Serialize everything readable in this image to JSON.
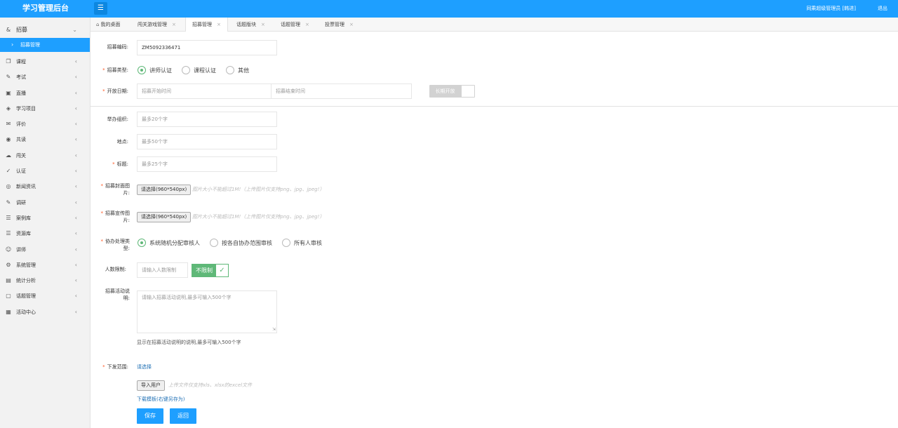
{
  "header": {
    "brand": "学习管理后台",
    "menu_icon": "hamburger-icon",
    "user": "同乘超级管理员 [韩进]",
    "logout": "退出"
  },
  "sidebar": {
    "groups": [
      {
        "label": "招募",
        "icon": "ampersand-icon",
        "open": true
      },
      {
        "label": "课程",
        "icon": "book-icon"
      },
      {
        "label": "考试",
        "icon": "edit-icon"
      },
      {
        "label": "直播",
        "icon": "video-icon"
      },
      {
        "label": "学习项目",
        "icon": "layers-icon"
      },
      {
        "label": "评价",
        "icon": "comment-icon"
      },
      {
        "label": "共读",
        "icon": "eye-icon"
      },
      {
        "label": "闯关",
        "icon": "cloud-icon"
      },
      {
        "label": "认证",
        "icon": "check-circle-icon"
      },
      {
        "label": "新闻资讯",
        "icon": "news-icon"
      },
      {
        "label": "调研",
        "icon": "survey-icon"
      },
      {
        "label": "案例库",
        "icon": "database-icon"
      },
      {
        "label": "资源库",
        "icon": "stack-icon"
      },
      {
        "label": "讲师",
        "icon": "user-icon"
      },
      {
        "label": "系统管理",
        "icon": "gear-icon"
      },
      {
        "label": "统计分析",
        "icon": "chart-icon"
      },
      {
        "label": "话题管理",
        "icon": "topic-icon"
      },
      {
        "label": "活动中心",
        "icon": "activity-icon"
      }
    ],
    "sub_item": "招募管理"
  },
  "tabs": [
    {
      "label": "我的桌面",
      "icon": "home-icon"
    },
    {
      "label": "闯关游戏管理"
    },
    {
      "label": "招募管理",
      "active": true
    },
    {
      "label": "话题版块"
    },
    {
      "label": "话题管理"
    },
    {
      "label": "投票管理"
    }
  ],
  "form": {
    "code_label": "招募编码:",
    "code_value": "ZM5092336471",
    "type_label": "招募类型:",
    "type_options": [
      "讲师认证",
      "课程认证",
      "其他"
    ],
    "date_label": "开放日期:",
    "start_placeholder": "招募开始时间",
    "end_placeholder": "招募结束时间",
    "long_term": "长期开放",
    "org_label": "举办组织:",
    "org_placeholder": "最多20个字",
    "place_label": "地点:",
    "place_placeholder": "最多50个字",
    "title_label": "标题:",
    "title_placeholder": "最多25个字",
    "cover_label": "招募封面图片:",
    "cover_btn": "请选择(960*540px)",
    "cover_hint": "图片大小不能超过1M!（上传图片仅支持png、jpg、jpeg!）",
    "promo_label": "招募宣传图片:",
    "promo_btn": "请选择(960*540px)",
    "promo_hint": "图片大小不能超过1M!（上传图片仅支持png、jpg、jpeg!）",
    "assist_label": "协办处理类型:",
    "assist_options": [
      "系统随机分配审核人",
      "按各自协办范围审核",
      "所有人审核"
    ],
    "count_label": "人数限制:",
    "count_placeholder": "请输入人数限制",
    "unlimited": "不限制",
    "desc_label": "招募活动说明:",
    "desc_placeholder": "请输入招募活动说明,最多可输入500个字",
    "desc_help": "显示在招募活动说明的说明,最多可输入500个字",
    "scope_label": "下发范围:",
    "scope_link": "请选择",
    "import_btn": "导入用户",
    "import_hint": "上传文件仅支持xls、xlsx的excel文件",
    "download_link": "下载模板(右键另存为)",
    "save_btn": "保存",
    "back_btn": "返回"
  }
}
